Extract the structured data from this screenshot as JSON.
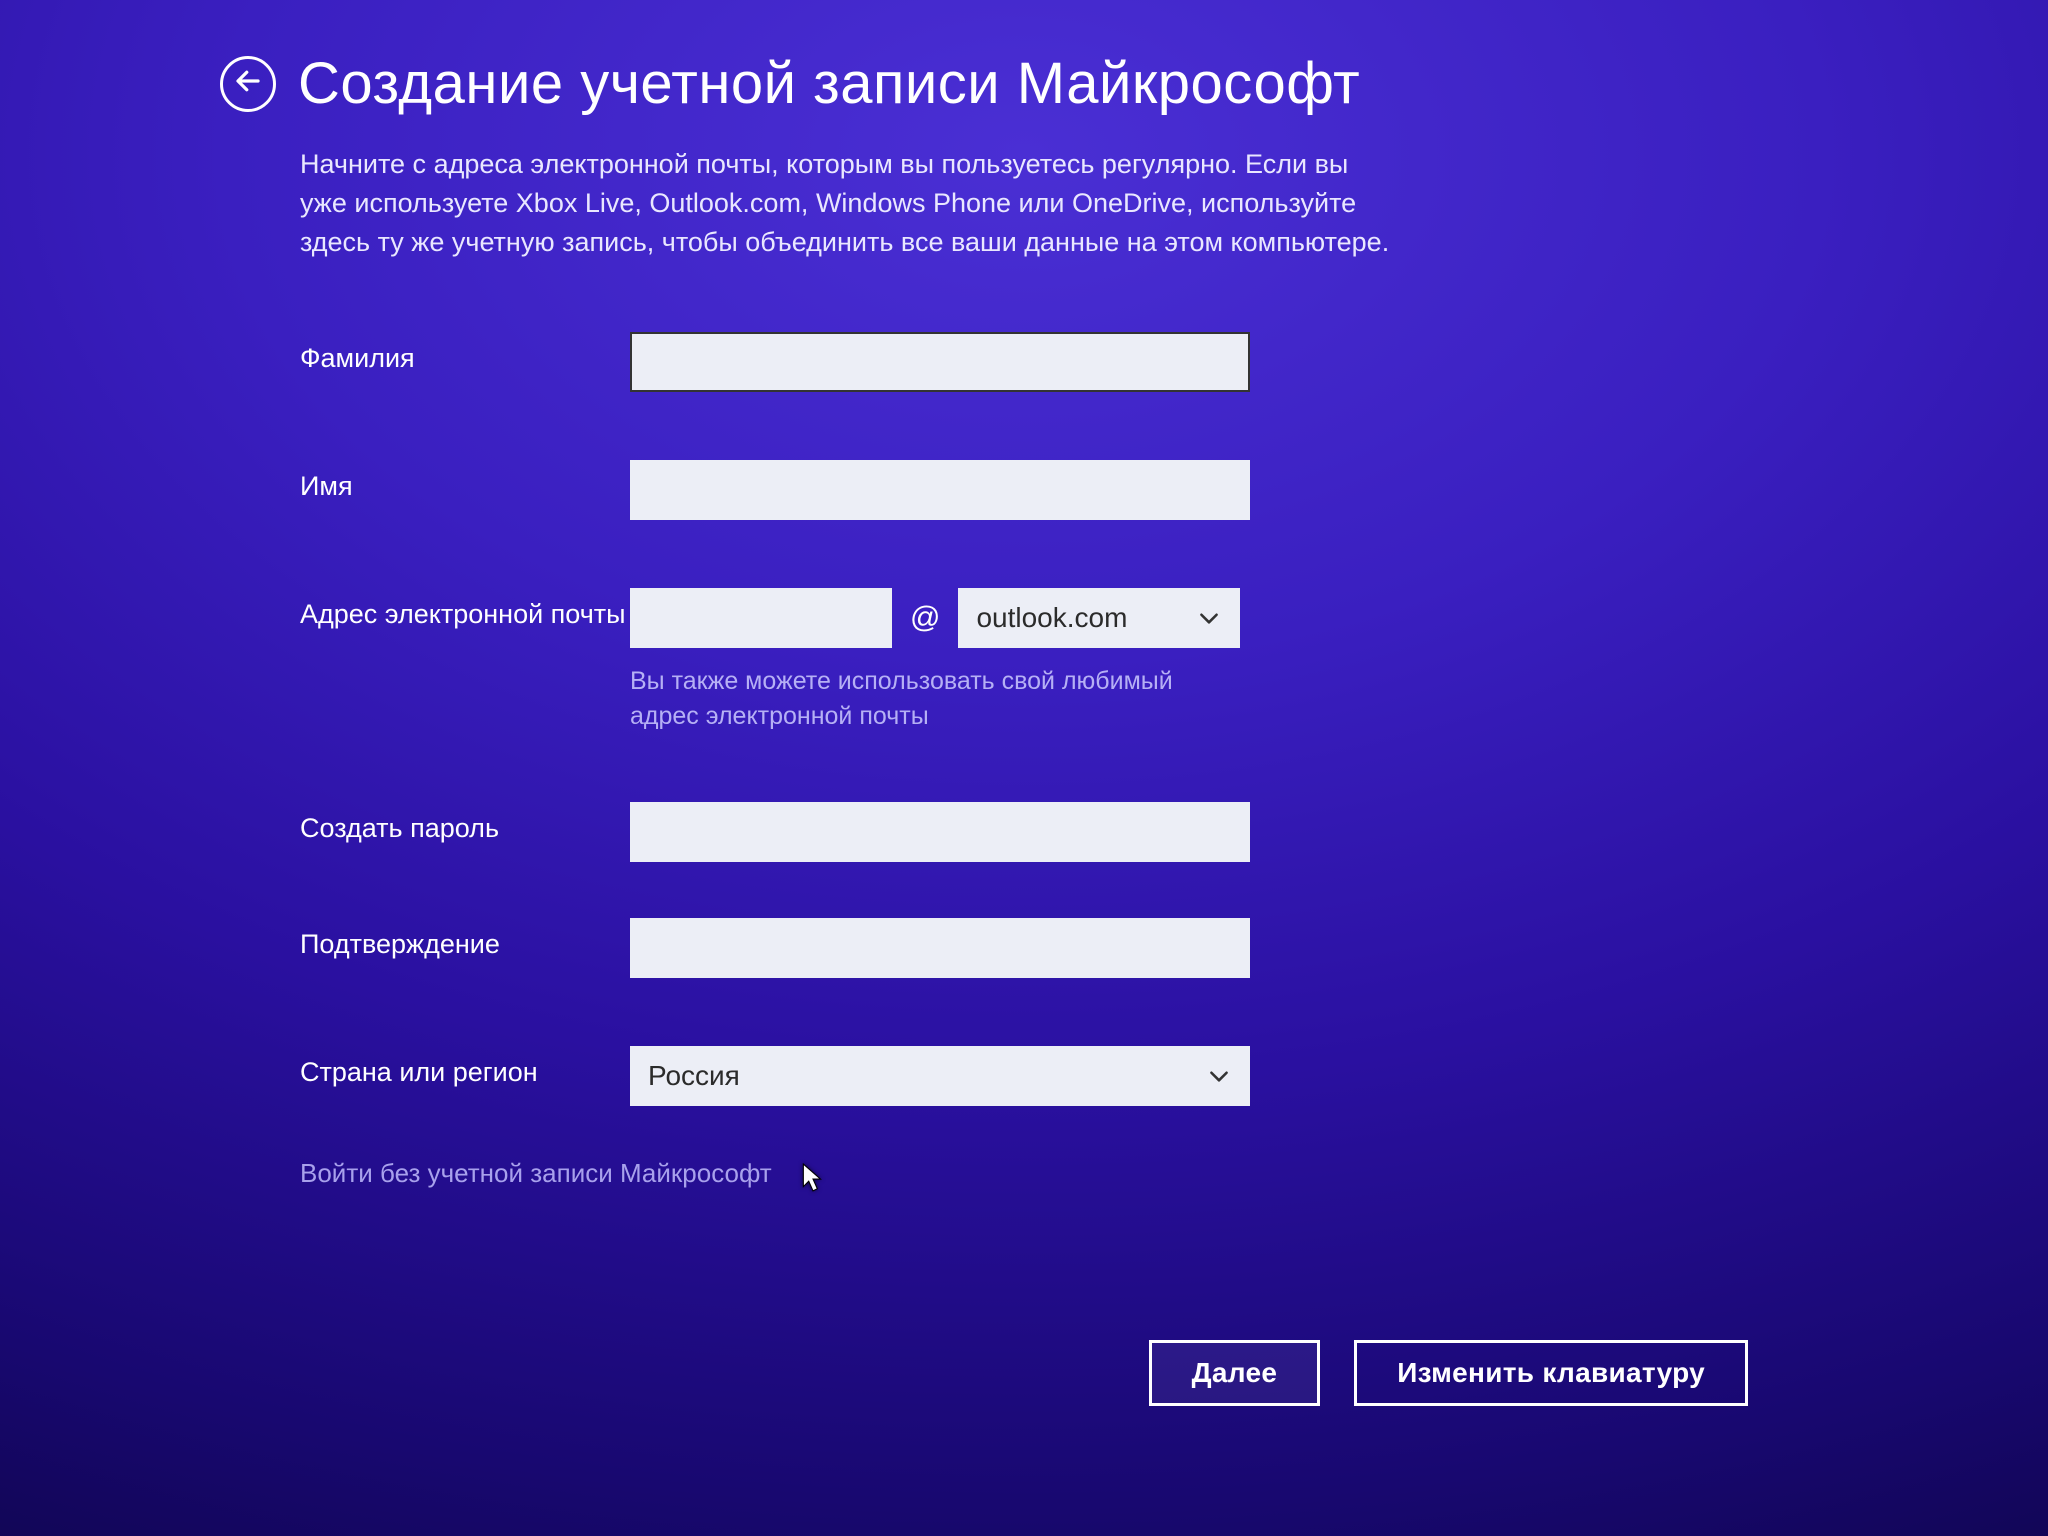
{
  "header": {
    "title": "Создание учетной записи Майкрософт"
  },
  "subtitle": "Начните с адреса электронной почты, которым вы пользуетесь регулярно. Если вы уже используете Xbox Live, Outlook.com, Windows Phone или OneDrive, используйте здесь ту же учетную запись, чтобы объединить все ваши данные на этом компьютере.",
  "form": {
    "last_name": {
      "label": "Фамилия",
      "value": ""
    },
    "first_name": {
      "label": "Имя",
      "value": ""
    },
    "email": {
      "label": "Адрес электронной почты",
      "local_value": "",
      "at": "@",
      "domain_selected": "outlook.com",
      "hint": "Вы также можете использовать свой любимый адрес электронной почты"
    },
    "password": {
      "label": "Создать пароль",
      "value": ""
    },
    "confirm": {
      "label": "Подтверждение",
      "value": ""
    },
    "country": {
      "label": "Страна или регион",
      "selected": "Россия"
    }
  },
  "links": {
    "no_account": "Войти без учетной записи Майкрософт"
  },
  "buttons": {
    "next": "Далее",
    "change_keyboard": "Изменить клавиатуру"
  }
}
